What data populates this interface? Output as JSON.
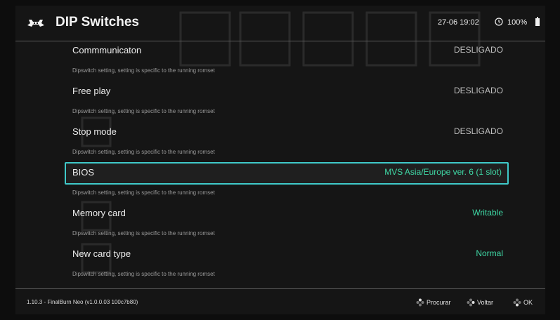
{
  "header": {
    "title": "DIP Switches",
    "clock": "27-06 19:02",
    "battery": "100%"
  },
  "items": [
    {
      "label": "Commmunicaton",
      "value": "DESLIGADO",
      "sub": "Dipswitch setting, setting is specific to the running romset",
      "accent": false
    },
    {
      "label": "Free play",
      "value": "DESLIGADO",
      "sub": "Dipswitch setting, setting is specific to the running romset",
      "accent": false
    },
    {
      "label": "Stop mode",
      "value": "DESLIGADO",
      "sub": "Dipswitch setting, setting is specific to the running romset",
      "accent": false
    },
    {
      "label": "BIOS",
      "value": "MVS Asia/Europe ver. 6 (1 slot)",
      "sub": "Dipswitch setting, setting is specific to the running romset",
      "accent": true
    },
    {
      "label": "Memory card",
      "value": "Writable",
      "sub": "Dipswitch setting, setting is specific to the running romset",
      "accent": true
    },
    {
      "label": "New card type",
      "value": "Normal",
      "sub": "Dipswitch setting, setting is specific to the running romset",
      "accent": true
    }
  ],
  "footer": {
    "status": "1.10.3 - FinalBurn Neo (v1.0.0.03 100c7b80)",
    "hint_search": "Procurar",
    "hint_back": "Voltar",
    "hint_ok": "OK"
  },
  "colors": {
    "accent": "#3fd9a6",
    "selection_border": "#3fc9c9"
  }
}
